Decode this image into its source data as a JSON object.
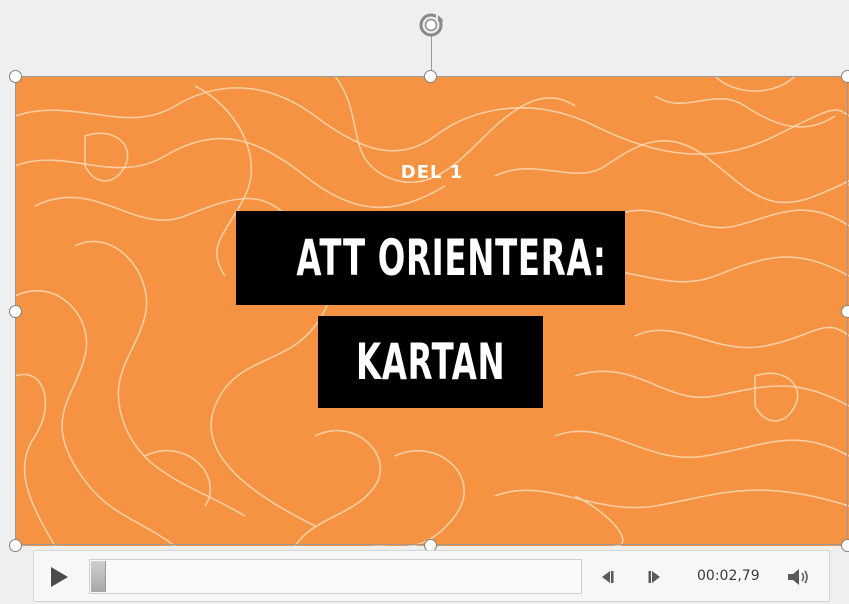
{
  "slide": {
    "kicker": "DEL 1",
    "title_line1": "ATT ORIENTERA:",
    "title_line2": "KARTAN",
    "background_color": "#f69342",
    "contour_color": "#ffd7b4"
  },
  "player": {
    "time": "00:02,79",
    "progress_fraction": 0.0,
    "icons": {
      "play": "play-icon",
      "step_back": "step-back-icon",
      "step_forward": "step-forward-icon",
      "volume": "volume-icon"
    }
  },
  "selection": {
    "rotate_icon": "rotate-handle-icon"
  }
}
